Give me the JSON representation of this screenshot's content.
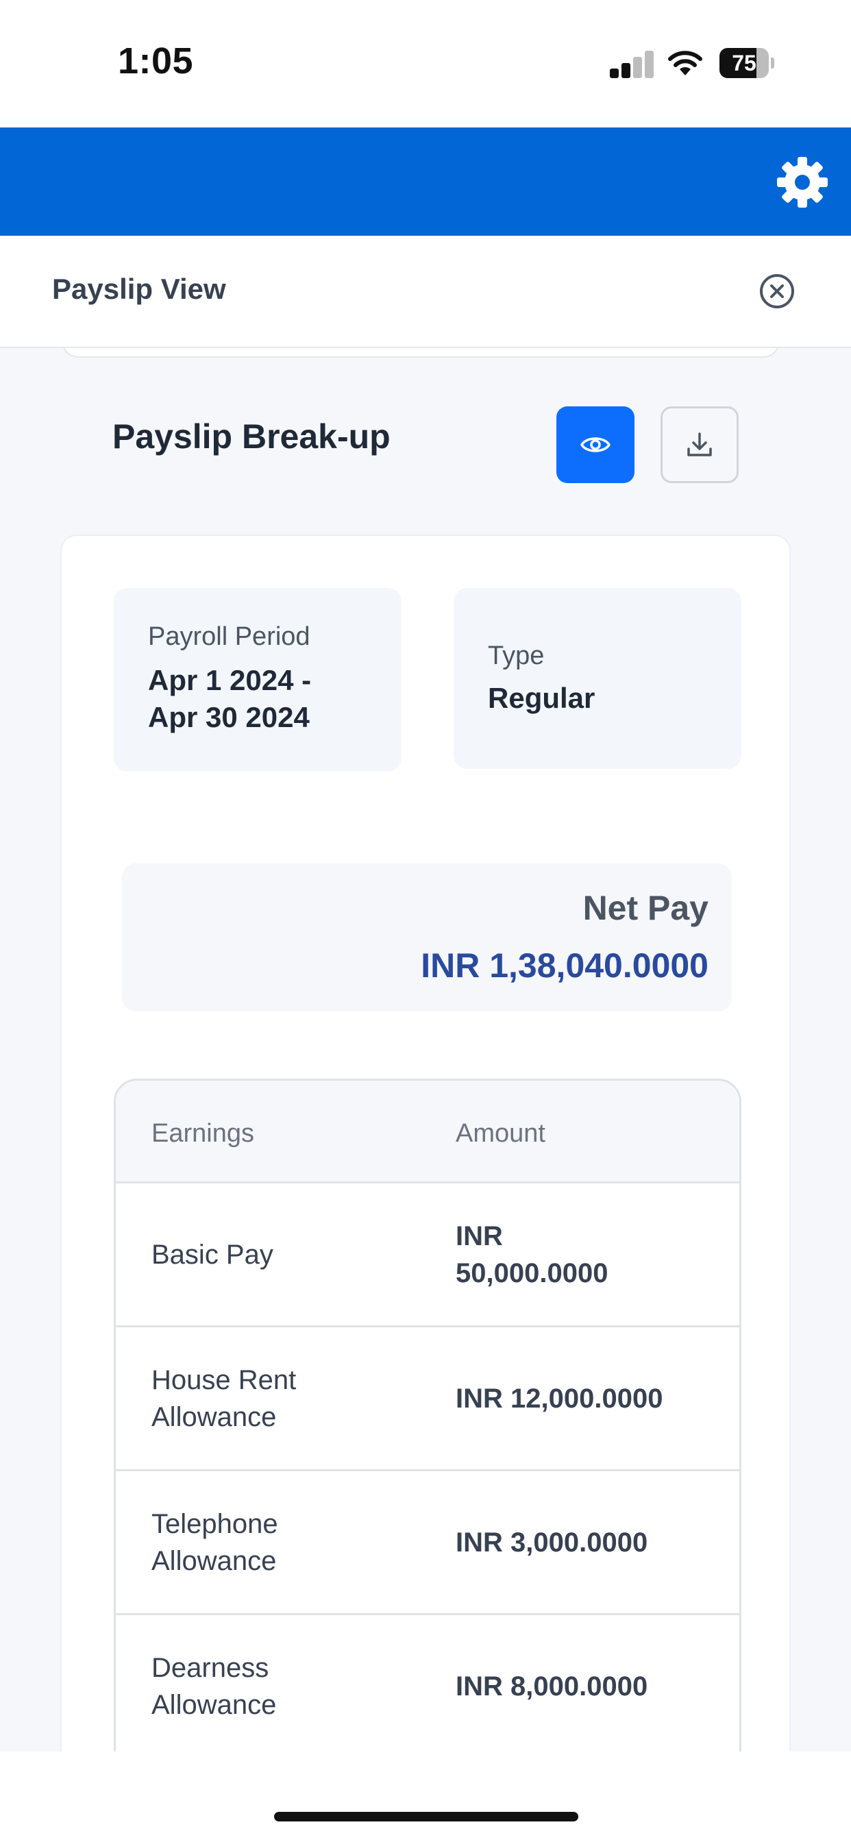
{
  "status_bar": {
    "time": "1:05",
    "battery": "75",
    "battery_level": 0.75
  },
  "app_bar": {
    "settings_icon": "gear-icon",
    "color": "#0366d6"
  },
  "sheet": {
    "title": "Payslip View",
    "close_icon": "close-circle-icon"
  },
  "breakup": {
    "title": "Payslip Break-up",
    "view_icon": "eye-icon",
    "download_icon": "download-icon",
    "accent": "#0d6efd"
  },
  "payroll": {
    "period_label": "Payroll Period",
    "period_line1": "Apr 1 2024 -",
    "period_line2": "Apr 30 2024",
    "type_label": "Type",
    "type_value": "Regular"
  },
  "net_pay": {
    "label": "Net Pay",
    "value": "INR 1,38,040.0000",
    "color": "#2a4a9e"
  },
  "earnings_table": {
    "headers": [
      "Earnings",
      "Amount"
    ],
    "rows": [
      {
        "name": "Basic Pay",
        "amount_line1": "INR",
        "amount_line2": "50,000.0000"
      },
      {
        "name_line1": "House Rent",
        "name_line2": "Allowance",
        "amount": "INR 12,000.0000"
      },
      {
        "name_line1": "Telephone",
        "name_line2": "Allowance",
        "amount": "INR 3,000.0000"
      },
      {
        "name_line1": "Dearness",
        "name_line2": "Allowance",
        "amount": "INR 8,000.0000"
      }
    ]
  }
}
